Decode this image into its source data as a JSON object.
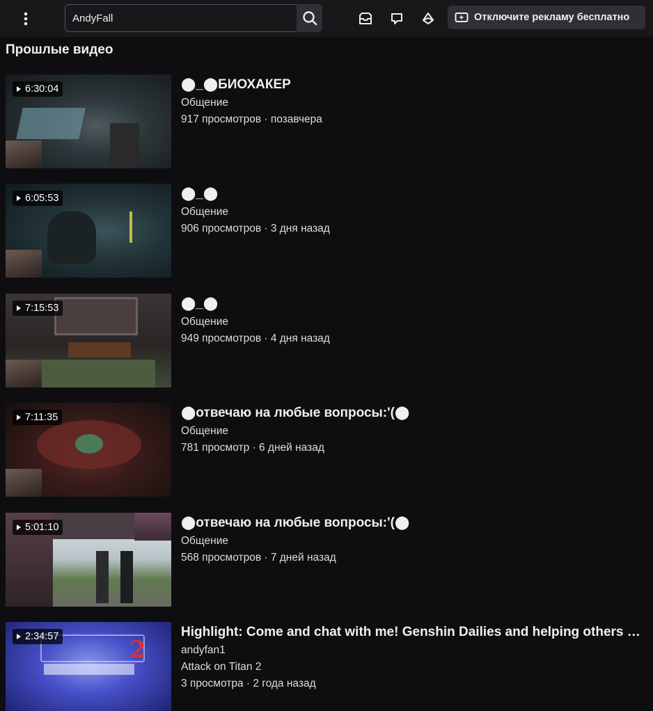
{
  "header": {
    "search_value": "AndyFall",
    "ad_button_label": "Отключите рекламу бесплатно",
    "icons": [
      "more-vertical-icon",
      "search-icon",
      "inbox-icon",
      "whispers-icon",
      "bits-icon",
      "ad-free-icon"
    ]
  },
  "section": {
    "title": "Прошлые видео"
  },
  "videos": [
    {
      "duration": "6:30:04",
      "title": "⬤_⬤БИОХАКЕР",
      "category": "Общение",
      "stats": "917 просмотров · позавчера"
    },
    {
      "duration": "6:05:53",
      "title": "⬤_⬤",
      "category": "Общение",
      "stats": "906 просмотров · 3 дня назад"
    },
    {
      "duration": "7:15:53",
      "title": "⬤_⬤",
      "category": "Общение",
      "stats": "949 просмотров · 4 дня назад"
    },
    {
      "duration": "7:11:35",
      "title": "⬤отвечаю на любые вопросы:'(⬤",
      "category": "Общение",
      "stats": "781 просмотр · 6 дней назад"
    },
    {
      "duration": "5:01:10",
      "title": "⬤отвечаю на любые вопросы:'(⬤",
      "category": "Общение",
      "stats": "568 просмотров · 7 дней назад"
    },
    {
      "duration": "2:34:57",
      "title": "Highlight: Come and chat with me! Genshin Dailies and helping others with Abyss",
      "channel": "andyfan1",
      "category": "Attack on Titan 2",
      "stats": "3 просмотра · 2 года назад"
    }
  ],
  "colors": {
    "background": "#0e0e10",
    "topbar": "#18181b",
    "button": "#2f2f35",
    "text": "#efeff1"
  }
}
